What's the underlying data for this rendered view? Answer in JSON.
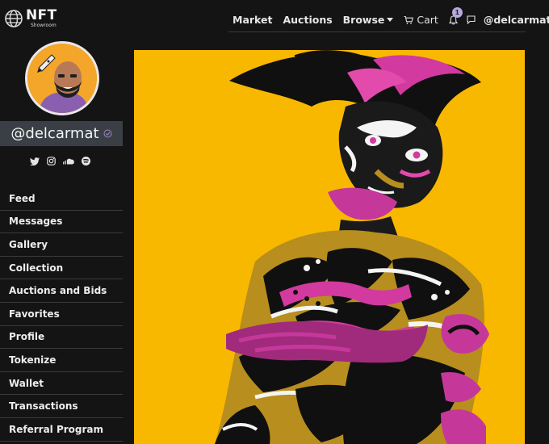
{
  "brand": {
    "title": "NFT",
    "subtitle": "Showroom",
    "icon": "globe-logo-icon"
  },
  "topnav": {
    "market": "Market",
    "auctions": "Auctions",
    "browse": "Browse",
    "cart": "Cart",
    "notifications_count": "1",
    "user": "@delcarmat"
  },
  "profile": {
    "username": "@delcarmat",
    "verified_icon": "verified-check-icon",
    "social_icons": [
      "twitter-icon",
      "instagram-icon",
      "soundcloud-icon",
      "spotify-icon"
    ]
  },
  "menu": [
    "Feed",
    "Messages",
    "Gallery",
    "Collection",
    "Auctions and Bids",
    "Favorites",
    "Profile",
    "Tokenize",
    "Wallet",
    "Transactions",
    "Referral Program"
  ],
  "colors": {
    "background": "#141414",
    "username_bar": "#3a3f45",
    "badge": "#b8a9df",
    "art_background": "#f9b800",
    "art_magenta": "#c5389a",
    "art_mustard": "#b88e1f"
  }
}
